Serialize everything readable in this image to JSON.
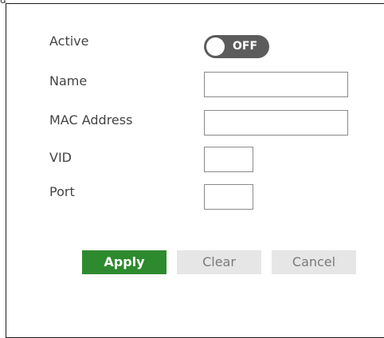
{
  "form": {
    "active_label": "Active",
    "active_toggle": {
      "state": "OFF",
      "on": false
    },
    "name_label": "Name",
    "name_value": "",
    "mac_label": "MAC Address",
    "mac_value": "",
    "vid_label": "VID",
    "vid_value": "",
    "port_label": "Port",
    "port_value": ""
  },
  "buttons": {
    "apply": "Apply",
    "clear": "Clear",
    "cancel": "Cancel"
  },
  "colors": {
    "apply_bg": "#2e8a2e",
    "toggle_off_bg": "#5c5c5c",
    "secondary_bg": "#e6e6e6"
  }
}
